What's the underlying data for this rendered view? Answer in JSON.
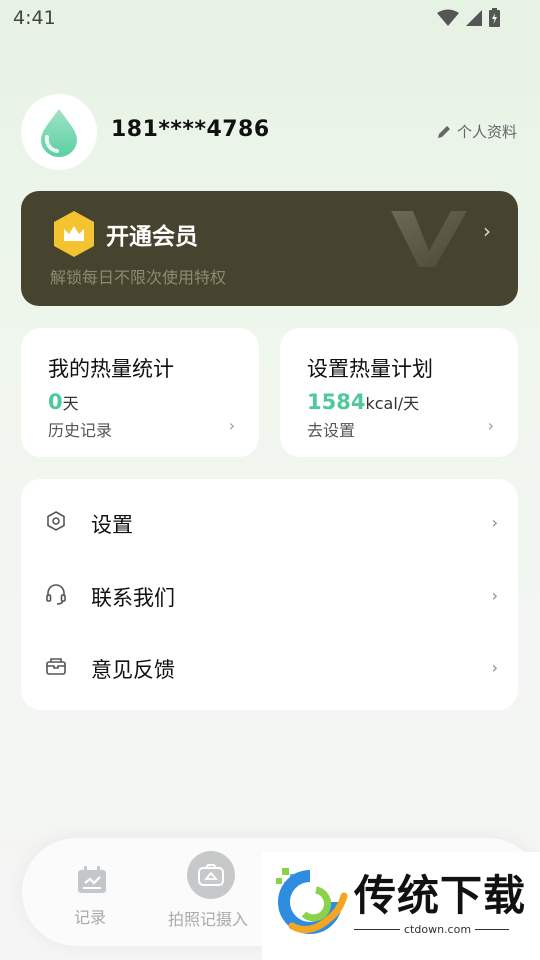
{
  "status_bar": {
    "time": "4:41"
  },
  "profile": {
    "phone": "181****4786",
    "edit_label": "个人资料"
  },
  "vip": {
    "title": "开通会员",
    "subtitle": "解锁每日不限次使用特权"
  },
  "stats": [
    {
      "title": "我的热量统计",
      "value": "0",
      "unit": "天",
      "sub": "历史记录"
    },
    {
      "title": "设置热量计划",
      "value": "1584",
      "unit": "kcal/天",
      "sub": "去设置"
    }
  ],
  "menu": [
    {
      "label": "设置",
      "icon": "hexagon-settings-icon"
    },
    {
      "label": "联系我们",
      "icon": "headset-icon"
    },
    {
      "label": "意见反馈",
      "icon": "feedback-box-icon"
    }
  ],
  "tabbar": {
    "record_label": "记录",
    "photo_label": "拍照记摄入"
  },
  "watermark": {
    "text": "传统下载",
    "url": "ctdown.com"
  },
  "colors": {
    "accent": "#4fc89a",
    "vip_bg": "#46432e",
    "vip_gold": "#f4c430"
  }
}
